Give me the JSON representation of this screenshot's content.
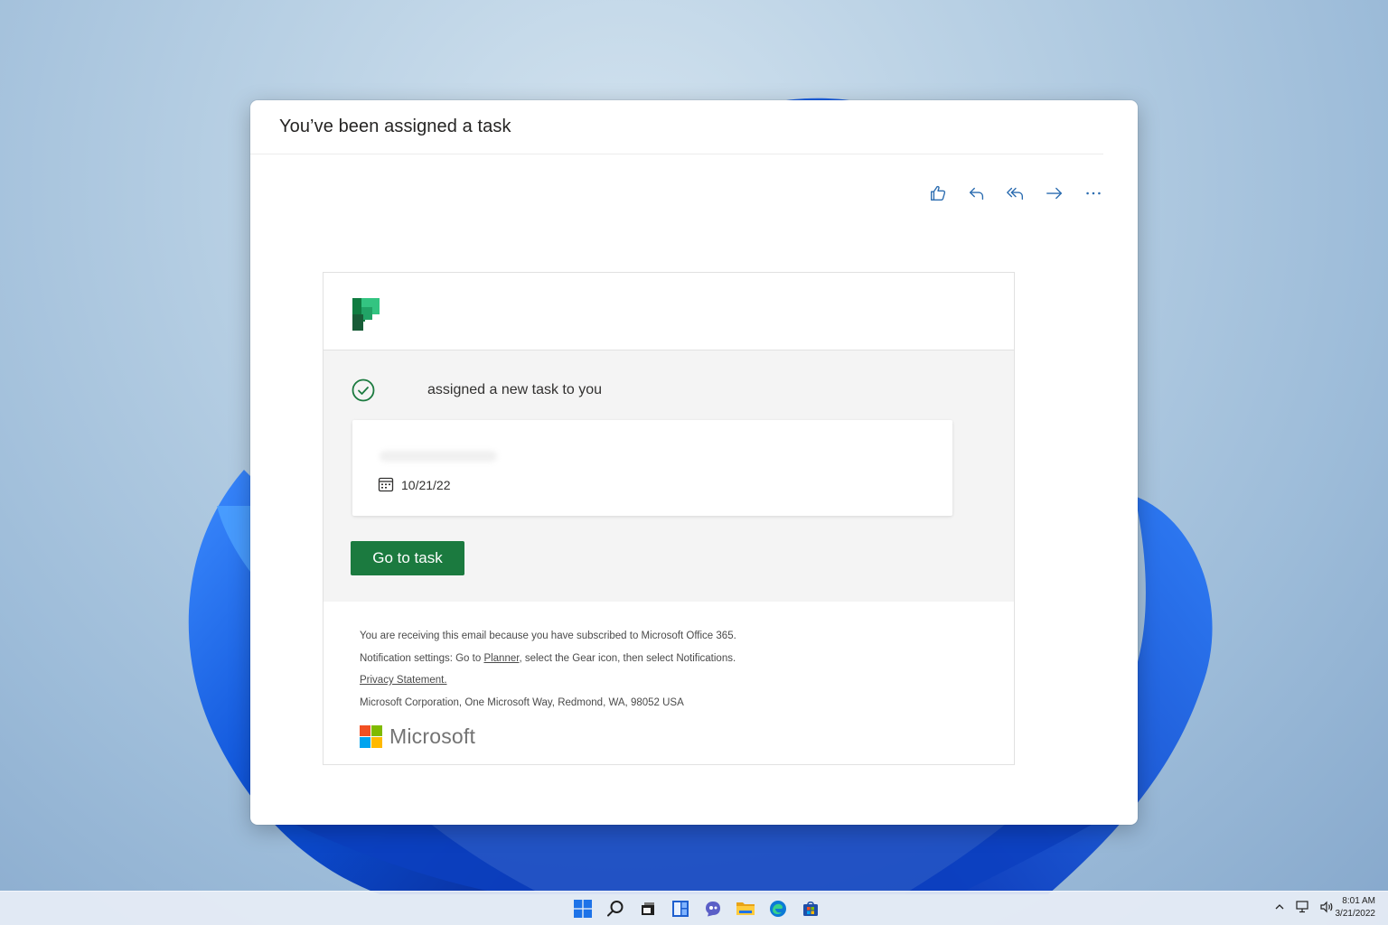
{
  "mail": {
    "subject": "You’ve been assigned a task",
    "actions": [
      {
        "name": "like",
        "icon": "thumbs-up-icon"
      },
      {
        "name": "reply",
        "icon": "reply-icon"
      },
      {
        "name": "reply-all",
        "icon": "reply-all-icon"
      },
      {
        "name": "forward",
        "icon": "forward-icon"
      },
      {
        "name": "more",
        "icon": "more-options-icon"
      }
    ]
  },
  "card": {
    "assigned_text": "assigned a new task to you",
    "due_date": "10/21/22",
    "go_button": "Go to task",
    "footer": {
      "line1": "You are receiving this email because you have subscribed to Microsoft Office 365.",
      "line2_prefix": "Notification settings: Go to ",
      "line2_link": "Planner",
      "line2_suffix": ", select the Gear icon, then select Notifications.",
      "privacy_link": "Privacy Statement.",
      "address": "Microsoft Corporation, One Microsoft Way, Redmond, WA, 98052 USA",
      "brand": "Microsoft"
    }
  },
  "taskbar": {
    "apps": [
      "start-icon",
      "search-icon",
      "task-view-icon",
      "widgets-icon",
      "chat-icon",
      "file-explorer-icon",
      "edge-icon",
      "store-icon"
    ],
    "tray": [
      "chevron-up-icon",
      "network-icon",
      "volume-icon"
    ],
    "time": "8:01 AM",
    "date": "3/21/2022"
  },
  "colors": {
    "accent_action": "#2b6cb0",
    "button_green": "#1b7a3f",
    "check_green": "#1b7a3f"
  }
}
